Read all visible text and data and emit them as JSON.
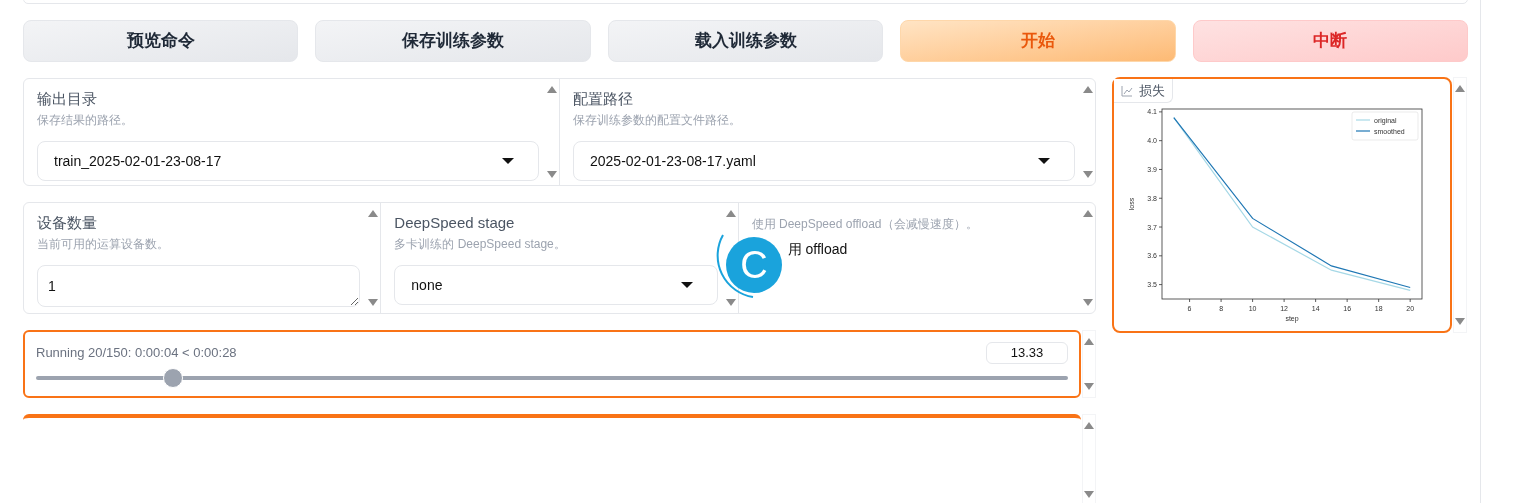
{
  "buttons": [
    {
      "label": "预览命令",
      "kind": "default"
    },
    {
      "label": "保存训练参数",
      "kind": "default"
    },
    {
      "label": "载入训练参数",
      "kind": "default"
    },
    {
      "label": "开始",
      "kind": "primary"
    },
    {
      "label": "中断",
      "kind": "stop"
    }
  ],
  "row1": [
    {
      "kind": "dropdown",
      "label": "输出目录",
      "info": "保存结果的路径。",
      "value": "train_2025-02-01-23-08-17"
    },
    {
      "kind": "dropdown",
      "label": "配置路径",
      "info": "保存训练参数的配置文件路径。",
      "value": "2025-02-01-23-08-17.yaml"
    }
  ],
  "row2": [
    {
      "kind": "textbox",
      "label": "设备数量",
      "info": "当前可用的运算设备数。",
      "value": "1"
    },
    {
      "kind": "dropdown",
      "label": "DeepSpeed stage",
      "info": "多卡训练的 DeepSpeed stage。",
      "value": "none"
    },
    {
      "kind": "checkbox",
      "info": "使用 DeepSpeed offload（会减慢速度）。",
      "label": "用 offload"
    }
  ],
  "overlay": {
    "letter": "C"
  },
  "progress": {
    "text": "Running 20/150: 0:00:04 < 0:00:28",
    "value": "13.33",
    "level": 0.133
  },
  "loss_panel": {
    "label": "损失",
    "chart_data": {
      "type": "line",
      "xlabel": "step",
      "ylabel": "loss",
      "x": [
        5,
        10,
        15,
        20
      ],
      "series": [
        {
          "name": "original",
          "color": "#a6d8e6",
          "values": [
            4.08,
            3.7,
            3.55,
            3.48
          ]
        },
        {
          "name": "smoothed",
          "color": "#1f77b4",
          "values": [
            4.08,
            3.73,
            3.565,
            3.49
          ]
        }
      ],
      "xlim": [
        4.25,
        20.75
      ],
      "ylim": [
        3.45,
        4.11
      ],
      "xticks": [
        6,
        8,
        10,
        12,
        14,
        16,
        18,
        20
      ],
      "yticks": [
        3.5,
        3.6,
        3.7,
        3.8,
        3.9,
        {
          "value": 4,
          "label": "4.0"
        },
        4.1
      ],
      "legend": "upper right"
    }
  }
}
